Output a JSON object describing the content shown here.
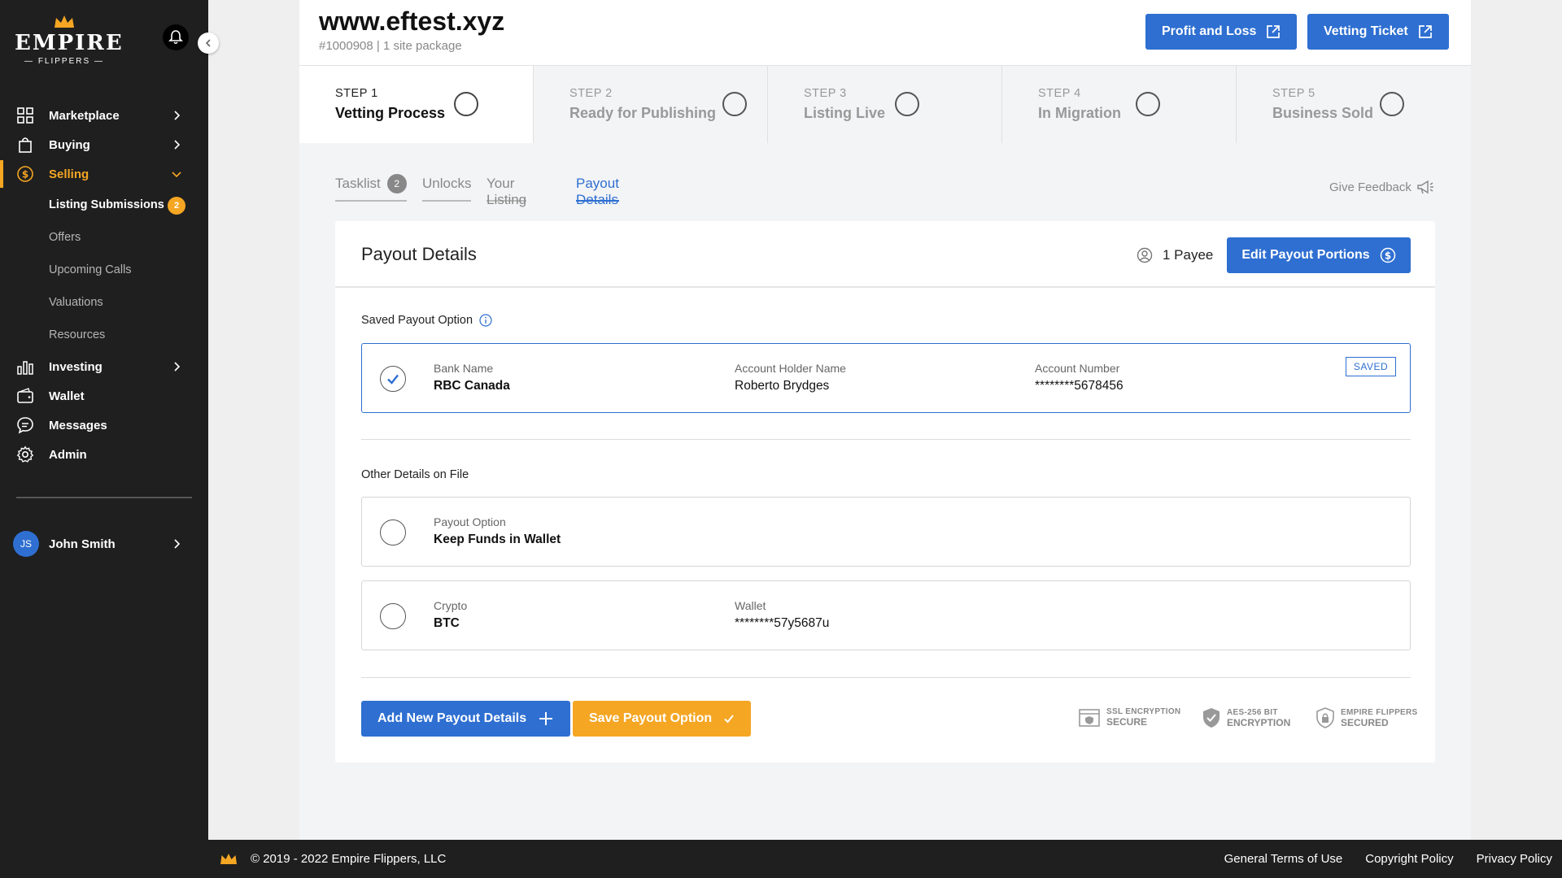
{
  "brand": {
    "name": "EMPIRE",
    "sub": "FLIPPERS"
  },
  "nav": {
    "items": [
      {
        "label": "Marketplace"
      },
      {
        "label": "Buying"
      },
      {
        "label": "Selling"
      },
      {
        "label": "Investing"
      },
      {
        "label": "Wallet"
      },
      {
        "label": "Messages"
      },
      {
        "label": "Admin"
      }
    ],
    "selling_sub": [
      {
        "label": "Listing Submissions",
        "badge": "2"
      },
      {
        "label": "Offers"
      },
      {
        "label": "Upcoming Calls"
      },
      {
        "label": "Valuations"
      },
      {
        "label": "Resources"
      }
    ]
  },
  "user": {
    "initials": "JS",
    "name": "John Smith"
  },
  "header": {
    "title": "www.eftest.xyz",
    "subtitle": "#1000908 | 1 site package",
    "profit_loss_label": "Profit and Loss",
    "vetting_ticket_label": "Vetting Ticket"
  },
  "steps": [
    {
      "num": "STEP 1",
      "name": "Vetting Process"
    },
    {
      "num": "STEP 2",
      "name": "Ready for Publishing"
    },
    {
      "num": "STEP 3",
      "name": "Listing Live"
    },
    {
      "num": "STEP 4",
      "name": "In Migration"
    },
    {
      "num": "STEP 5",
      "name": "Business Sold"
    }
  ],
  "tabs": [
    {
      "label": "Tasklist",
      "badge": "2"
    },
    {
      "label": "Unlocks"
    },
    {
      "label": "Your Listing"
    },
    {
      "label": "Payout Details"
    }
  ],
  "feedback_label": "Give Feedback",
  "payout": {
    "title": "Payout Details",
    "payee_count": "1 Payee",
    "edit_label": "Edit Payout Portions",
    "saved_label": "Saved Payout Option",
    "saved_option": {
      "bank_name_key": "Bank Name",
      "bank_name": "RBC Canada",
      "holder_key": "Account Holder Name",
      "holder": "Roberto Brydges",
      "account_key": "Account Number",
      "account": "********5678456",
      "tag": "SAVED"
    },
    "other_label": "Other Details on File",
    "wallet_option": {
      "key": "Payout Option",
      "value": "Keep Funds in Wallet"
    },
    "crypto_option": {
      "crypto_key": "Crypto",
      "crypto": "BTC",
      "wallet_key": "Wallet",
      "wallet": "********57y5687u"
    },
    "add_label": "Add New Payout Details",
    "save_label": "Save Payout Option",
    "security": [
      {
        "line1": "SSL ENCRYPTION",
        "line2": "SECURE"
      },
      {
        "line1": "AES-256 BIT",
        "line2": "ENCRYPTION"
      },
      {
        "line1": "EMPIRE FLIPPERS",
        "line2": "SECURED"
      }
    ]
  },
  "footer": {
    "copyright": "© 2019 - 2022 Empire Flippers, LLC",
    "links": [
      "General Terms of Use",
      "Copyright Policy",
      "Privacy Policy"
    ]
  },
  "colors": {
    "accent_blue": "#2e6fd1",
    "accent_orange": "#f5a623",
    "sidebar": "#1f1f1f"
  }
}
